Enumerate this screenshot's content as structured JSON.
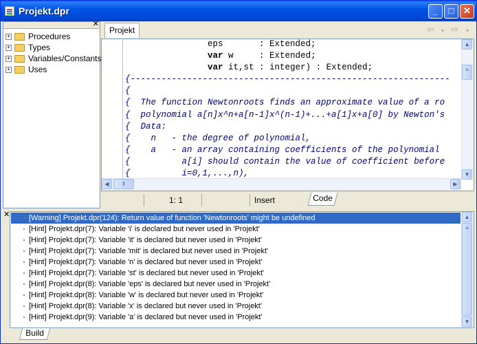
{
  "window": {
    "title": "Projekt.dpr"
  },
  "tree": {
    "items": [
      {
        "label": "Procedures"
      },
      {
        "label": "Types"
      },
      {
        "label": "Variables/Constants"
      },
      {
        "label": "Uses"
      }
    ]
  },
  "editor": {
    "tab_label": "Projekt",
    "code_tab_label": "Code",
    "status_position": "1:   1",
    "status_mode": "Insert",
    "code_lines": [
      {
        "text": "                eps       : Extended;",
        "kind": "code"
      },
      {
        "text": "                var w     : Extended;",
        "kind": "code"
      },
      {
        "text": "                var it,st : integer) : Extended;",
        "kind": "code"
      },
      {
        "text": "{--------------------------------------------------------------",
        "kind": "comment"
      },
      {
        "text": "{",
        "kind": "comment"
      },
      {
        "text": "{  The function Newtonroots finds an approximate value of a ro",
        "kind": "comment"
      },
      {
        "text": "{  polynomial a[n]x^n+a[n-1]x^(n-1)+...+a[1]x+a[0] by Newton's",
        "kind": "comment"
      },
      {
        "text": "{  Data:",
        "kind": "comment"
      },
      {
        "text": "{    n   - the degree of polynomial,",
        "kind": "comment"
      },
      {
        "text": "{    a   - an array containing coefficients of the polynomial",
        "kind": "comment"
      },
      {
        "text": "{          a[i] should contain the value of coefficient before",
        "kind": "comment"
      },
      {
        "text": "{          i=0,1,...,n),",
        "kind": "comment"
      }
    ]
  },
  "messages": {
    "tab_label": "Build",
    "items": [
      "[Warning] Projekt.dpr(124): Return value of function 'Newtonroots' might be undefined",
      "[Hint] Projekt.dpr(7): Variable 'i' is declared but never used in 'Projekt'",
      "[Hint] Projekt.dpr(7): Variable 'it' is declared but never used in 'Projekt'",
      "[Hint] Projekt.dpr(7): Variable 'mit' is declared but never used in 'Projekt'",
      "[Hint] Projekt.dpr(7): Variable 'n' is declared but never used in 'Projekt'",
      "[Hint] Projekt.dpr(7): Variable 'st' is declared but never used in 'Projekt'",
      "[Hint] Projekt.dpr(8): Variable 'eps' is declared but never used in 'Projekt'",
      "[Hint] Projekt.dpr(8): Variable 'w' is declared but never used in 'Projekt'",
      "[Hint] Projekt.dpr(8): Variable 'x' is declared but never used in 'Projekt'",
      "[Hint] Projekt.dpr(9): Variable 'a' is declared but never used in 'Projekt'"
    ]
  }
}
